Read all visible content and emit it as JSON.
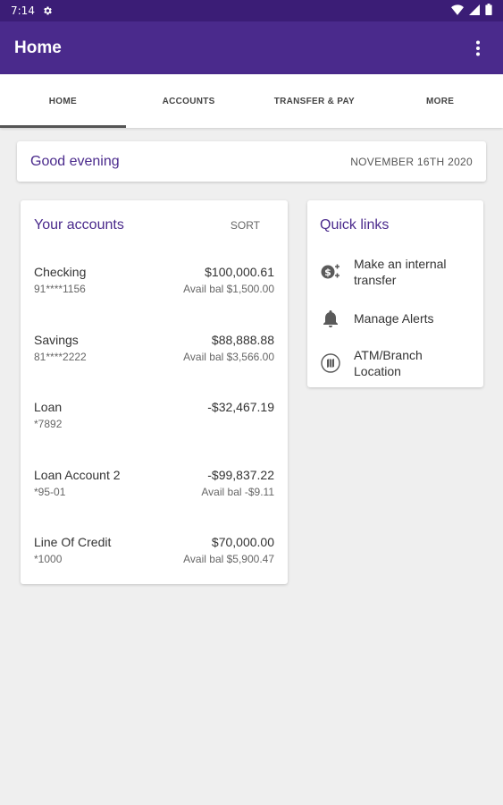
{
  "status_bar": {
    "time": "7:14",
    "icons": [
      "gear-icon",
      "wifi-icon",
      "signal-icon",
      "battery-icon"
    ]
  },
  "app_bar": {
    "title": "Home",
    "menu_icon": "more-vert-icon"
  },
  "tabs": [
    {
      "label": "HOME",
      "active": true
    },
    {
      "label": "ACCOUNTS",
      "active": false
    },
    {
      "label": "TRANSFER & PAY",
      "active": false
    },
    {
      "label": "MORE",
      "active": false
    }
  ],
  "greeting": {
    "text": "Good evening",
    "date": "NOVEMBER 16TH 2020"
  },
  "accounts": {
    "title": "Your accounts",
    "sort_label": "SORT",
    "items": [
      {
        "name": "Checking",
        "number": "91****1156",
        "balance": "$100,000.61",
        "avail": "Avail bal $1,500.00"
      },
      {
        "name": "Savings",
        "number": "81****2222",
        "balance": "$88,888.88",
        "avail": "Avail bal $3,566.00"
      },
      {
        "name": "Loan",
        "number": "*7892",
        "balance": "-$32,467.19",
        "avail": ""
      },
      {
        "name": "Loan Account 2",
        "number": "*95-01",
        "balance": "-$99,837.22",
        "avail": "Avail bal -$9.11"
      },
      {
        "name": "Line Of Credit",
        "number": "*1000",
        "balance": "$70,000.00",
        "avail": "Avail bal $5,900.47"
      }
    ]
  },
  "quick_links": {
    "title": "Quick links",
    "items": [
      {
        "label": "Make an internal transfer",
        "icon": "transfer-money-icon"
      },
      {
        "label": "Manage Alerts",
        "icon": "bell-icon"
      },
      {
        "label": "ATM/Branch Location",
        "icon": "map-icon"
      }
    ]
  },
  "colors": {
    "primary": "#4a2a8c",
    "status_bar": "#3b1d76",
    "background": "#efefef"
  }
}
